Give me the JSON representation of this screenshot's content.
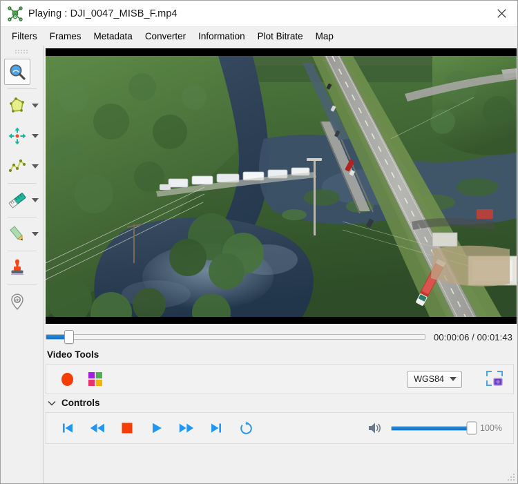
{
  "window": {
    "title": "Playing : DJI_0047_MISB_F.mp4",
    "app_icon": "drone-icon",
    "close_label": "✕"
  },
  "menubar": {
    "items": [
      {
        "label": "Filters",
        "name": "menu-filters"
      },
      {
        "label": "Frames",
        "name": "menu-frames"
      },
      {
        "label": "Metadata",
        "name": "menu-metadata"
      },
      {
        "label": "Converter",
        "name": "menu-converter"
      },
      {
        "label": "Information",
        "name": "menu-information"
      },
      {
        "label": "Plot Bitrate",
        "name": "menu-plot-bitrate"
      },
      {
        "label": "Map",
        "name": "menu-map"
      }
    ]
  },
  "toolbar": {
    "items": [
      {
        "icon": "magnifier-icon",
        "selected": true,
        "has_dropdown": false
      },
      {
        "icon": "polygon-icon",
        "selected": false,
        "has_dropdown": true
      },
      {
        "icon": "target-arrows-icon",
        "selected": false,
        "has_dropdown": true
      },
      {
        "icon": "polyline-icon",
        "selected": false,
        "has_dropdown": true
      },
      {
        "icon": "ruler-icon",
        "selected": false,
        "has_dropdown": true
      },
      {
        "icon": "pencil-icon",
        "selected": false,
        "has_dropdown": true
      },
      {
        "icon": "stamp-icon",
        "selected": false,
        "has_dropdown": false
      },
      {
        "icon": "map-pin-icon",
        "selected": false,
        "has_dropdown": false
      }
    ]
  },
  "video": {
    "scene_description": "Aerial drone view of flooded river, trees, highway bridge with red semi-truck and parked RVs",
    "letterbox": true
  },
  "timeline": {
    "current_time": "00:00:06",
    "total_time": "00:01:43",
    "time_display": "00:00:06 / 00:01:43",
    "progress_percent": 6,
    "fill_color": "#1f7fd0"
  },
  "video_tools": {
    "title": "Video Tools",
    "record_button": {
      "name": "record-button",
      "color": "#f53d06"
    },
    "color_grid_button": {
      "name": "color-grid-button",
      "colors": [
        "#a41fe0",
        "#4caf50",
        "#e8336d",
        "#f5b400"
      ]
    },
    "crs_combo": {
      "value": "WGS84",
      "options": [
        "WGS84"
      ]
    },
    "snapshot_button": {
      "name": "snapshot-button"
    }
  },
  "controls": {
    "title": "Controls",
    "expanded": true,
    "buttons": [
      {
        "name": "skip-to-start-button",
        "icon": "skip-back-icon",
        "color": "#2196f3"
      },
      {
        "name": "rewind-button",
        "icon": "rewind-icon",
        "color": "#2196f3"
      },
      {
        "name": "stop-button",
        "icon": "stop-icon",
        "color": "#f53d06"
      },
      {
        "name": "play-button",
        "icon": "play-icon",
        "color": "#2196f3"
      },
      {
        "name": "fast-forward-button",
        "icon": "fast-forward-icon",
        "color": "#2196f3"
      },
      {
        "name": "skip-to-end-button",
        "icon": "skip-forward-icon",
        "color": "#2196f3"
      },
      {
        "name": "loop-button",
        "icon": "loop-icon",
        "color": "#2196f3"
      }
    ],
    "volume": {
      "icon": "speaker-icon",
      "percent": 100,
      "label": "100%"
    }
  }
}
